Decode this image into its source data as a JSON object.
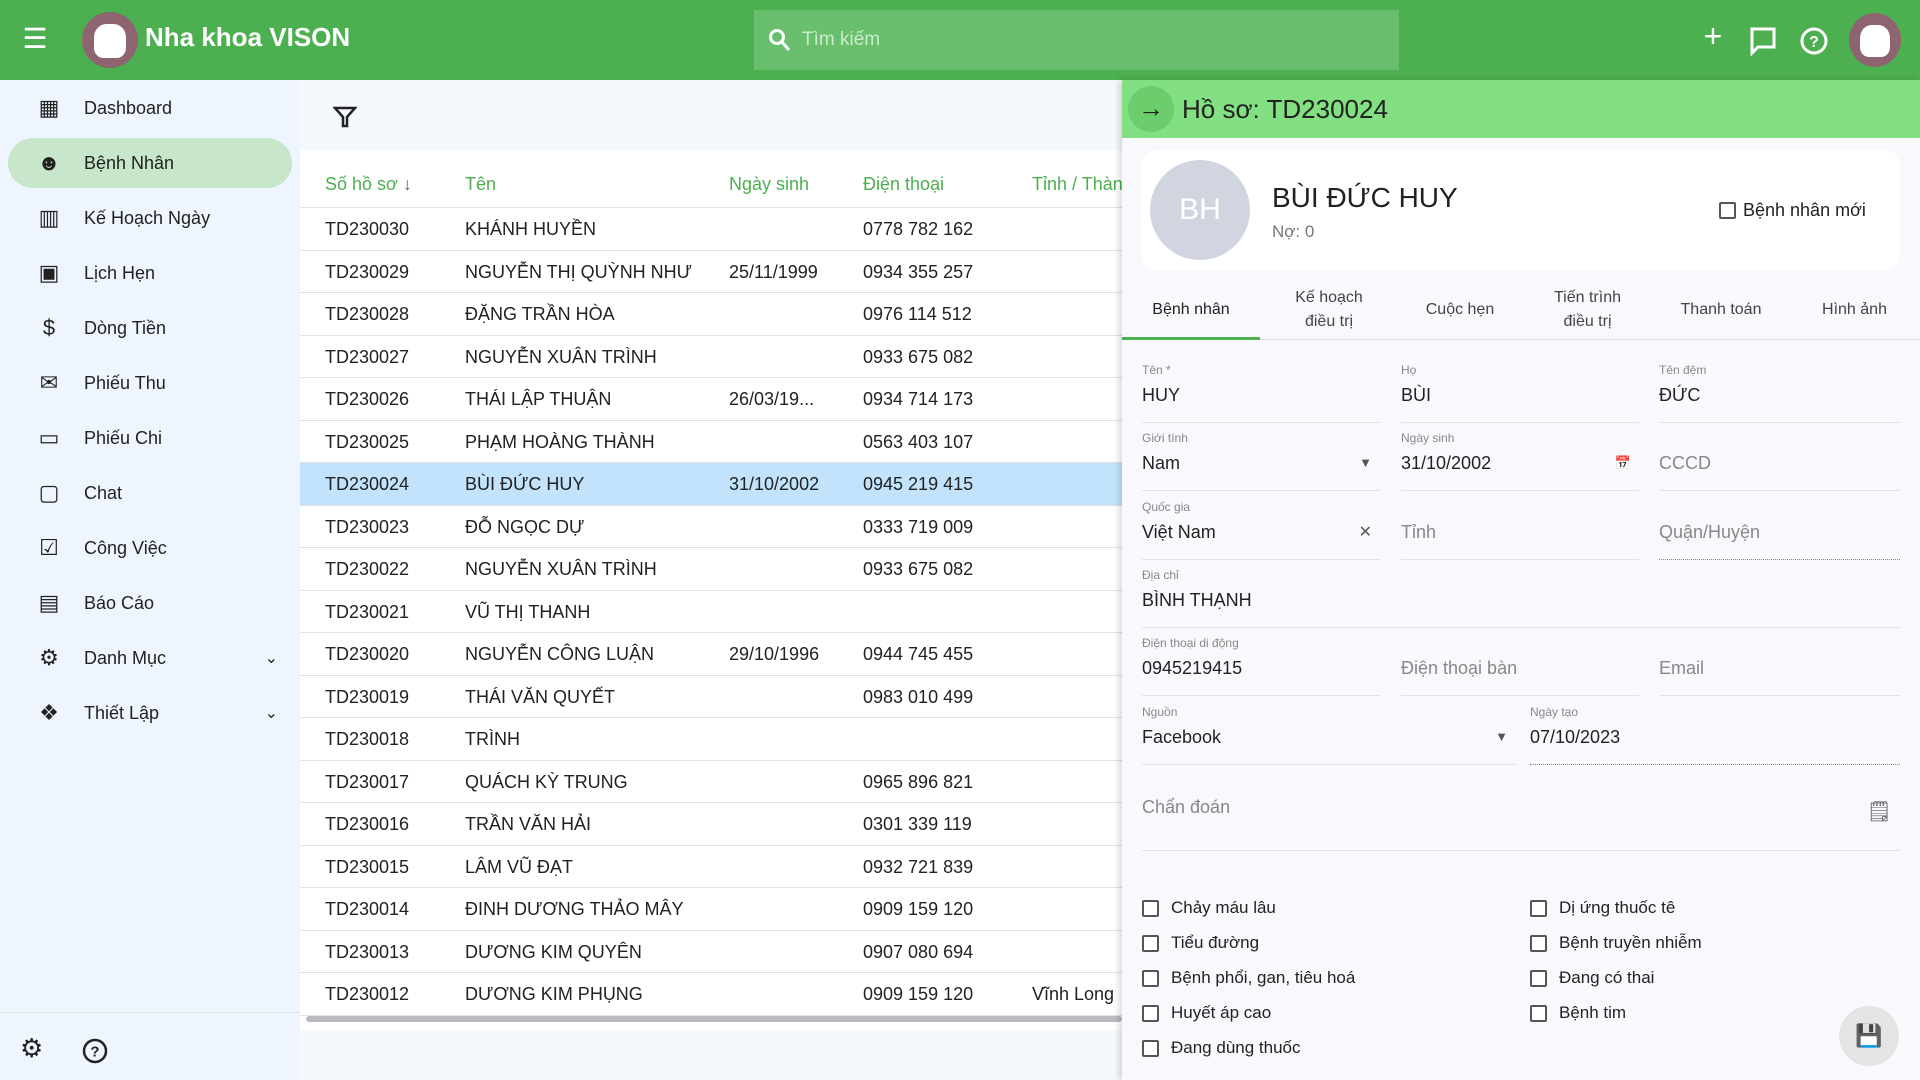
{
  "header": {
    "title": "Nha khoa VISON",
    "search_placeholder": "Tìm kiếm",
    "icons": [
      "menu-collapse-icon",
      "plus-icon",
      "chat-icon",
      "help-icon"
    ]
  },
  "sidebar": {
    "items": [
      {
        "label": "Dashboard",
        "icon": "dashboard-icon"
      },
      {
        "label": "Bệnh Nhân",
        "icon": "patient-icon",
        "active": true
      },
      {
        "label": "Kế Hoạch Ngày",
        "icon": "calendar-view-icon"
      },
      {
        "label": "Lịch Hẹn",
        "icon": "appointment-icon"
      },
      {
        "label": "Dòng Tiền",
        "icon": "dollar-icon"
      },
      {
        "label": "Phiếu Thu",
        "icon": "mail-icon"
      },
      {
        "label": "Phiếu Chi",
        "icon": "card-icon"
      },
      {
        "label": "Chat",
        "icon": "chat-icon"
      },
      {
        "label": "Công Việc",
        "icon": "checklist-icon"
      },
      {
        "label": "Báo Cáo",
        "icon": "report-icon"
      },
      {
        "label": "Danh Mục",
        "icon": "gears-icon",
        "expandable": true
      },
      {
        "label": "Thiết Lập",
        "icon": "settings-tree-icon",
        "expandable": true
      }
    ]
  },
  "table": {
    "columns": [
      "Số hồ sơ",
      "Tên",
      "Ngày sinh",
      "Điện thoại",
      "Tỉnh / Thàn"
    ],
    "sort_column": "Số hồ sơ",
    "sort_direction": "desc",
    "rows": [
      [
        "TD230030",
        "KHÁNH HUYỀN",
        "",
        "0778 782 162",
        ""
      ],
      [
        "TD230029",
        "NGUYỄN THỊ QUỲNH NHƯ",
        "25/11/1999",
        "0934 355 257",
        ""
      ],
      [
        "TD230028",
        "ĐẶNG TRẦN HÒA",
        "",
        "0976 114 512",
        ""
      ],
      [
        "TD230027",
        "NGUYỄN XUÂN TRÌNH",
        "",
        "0933 675 082",
        ""
      ],
      [
        "TD230026",
        "THÁI LẬP THUẬN",
        "26/03/19...",
        "0934 714 173",
        ""
      ],
      [
        "TD230025",
        "PHẠM HOÀNG THÀNH",
        "",
        "0563 403 107",
        ""
      ],
      [
        "TD230024",
        "BÙI ĐỨC HUY",
        "31/10/2002",
        "0945 219 415",
        ""
      ],
      [
        "TD230023",
        "ĐỖ NGỌC DỰ",
        "",
        "0333 719 009",
        ""
      ],
      [
        "TD230022",
        "NGUYỄN XUÂN TRÌNH",
        "",
        "0933 675 082",
        ""
      ],
      [
        "TD230021",
        "VŨ THỊ THANH",
        "",
        "",
        ""
      ],
      [
        "TD230020",
        "NGUYỄN CÔNG LUẬN",
        "29/10/1996",
        "0944 745 455",
        ""
      ],
      [
        "TD230019",
        "THÁI VĂN QUYẾT",
        "",
        "0983 010 499",
        ""
      ],
      [
        "TD230018",
        "TRÌNH",
        "",
        "",
        ""
      ],
      [
        "TD230017",
        "QUÁCH KỲ TRUNG",
        "",
        "0965 896 821",
        ""
      ],
      [
        "TD230016",
        "TRẦN VĂN HẢI",
        "",
        "0301 339 119",
        ""
      ],
      [
        "TD230015",
        "LÂM VŨ ĐẠT",
        "",
        "0932 721 839",
        ""
      ],
      [
        "TD230014",
        "ĐINH DƯƠNG THẢO MÂY",
        "",
        "0909 159 120",
        ""
      ],
      [
        "TD230013",
        "DƯƠNG KIM QUYÊN",
        "",
        "0907 080 694",
        ""
      ],
      [
        "TD230012",
        "DƯƠNG KIM PHỤNG",
        "",
        "0909 159 120",
        "Vĩnh Long"
      ]
    ],
    "selected_row": "TD230024"
  },
  "panel": {
    "title": "Hồ sơ: TD230024",
    "initials": "BH",
    "name": "BÙI ĐỨC HUY",
    "debt": "Nợ: 0",
    "new_patient_label": "Bệnh nhân mới",
    "new_patient_checked": false,
    "tabs": [
      "Bệnh nhân",
      "Kế hoạch\nđiều trị",
      "Cuộc hẹn",
      "Tiến trình\nđiều trị",
      "Thanh toán",
      "Hình ảnh"
    ],
    "active_tab": "Bệnh nhân",
    "form": {
      "first_name": {
        "label": "Tên *",
        "value": "HUY"
      },
      "last_name": {
        "label": "Họ",
        "value": "BÙI"
      },
      "middle_name": {
        "label": "Tên đệm",
        "value": "ĐỨC"
      },
      "gender": {
        "label": "Giới tính",
        "value": "Nam"
      },
      "dob": {
        "label": "Ngày sinh",
        "value": "31/10/2002"
      },
      "id_card": {
        "placeholder": "CCCD"
      },
      "country": {
        "label": "Quốc gia",
        "value": "Việt Nam"
      },
      "province": {
        "placeholder": "Tỉnh"
      },
      "district": {
        "placeholder": "Quận/Huyện"
      },
      "address": {
        "label": "Địa chỉ",
        "value": "BÌNH THẠNH"
      },
      "mobile": {
        "label": "Điện thoại di động",
        "value": "0945219415"
      },
      "landline": {
        "placeholder": "Điện thoại bàn"
      },
      "email": {
        "placeholder": "Email"
      },
      "source": {
        "label": "Nguồn",
        "value": "Facebook"
      },
      "created": {
        "label": "Ngày tạo",
        "value": "07/10/2023"
      },
      "diagnosis": {
        "placeholder": "Chẩn đoán"
      }
    },
    "conditions_left": [
      "Chảy máu lâu",
      "Tiểu đường",
      "Bệnh phổi, gan, tiêu hoá",
      "Huyết áp cao",
      "Đang dùng thuốc"
    ],
    "conditions_right": [
      "Dị ứng thuốc tê",
      "Bệnh truyền nhiễm",
      "Đang có thai",
      "Bệnh tim"
    ]
  },
  "colors": {
    "primary": "#4caf50",
    "panel_header": "#82e082",
    "selected_row": "#c2e3fb",
    "active_nav": "#c8e6c9"
  }
}
